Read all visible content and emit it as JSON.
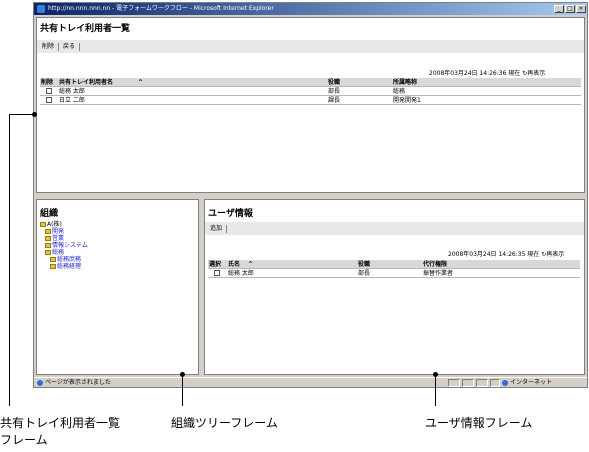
{
  "window": {
    "title": "http://nn.nnn.nnn.nn - 電子フォームワークフロー - Microsoft Internet Explorer",
    "controls": [
      "_",
      "□",
      "×"
    ]
  },
  "top_frame": {
    "title": "共有トレイ利用者一覧",
    "toolbar": [
      "削除",
      "戻る"
    ],
    "timestamp": "2008年03月24日 14:26:36 現在",
    "refresh_label": "再表示",
    "columns": [
      "削除",
      "共有トレイ利用者名",
      "役職",
      "所属略称"
    ],
    "rows": [
      {
        "name": "総務 太郎",
        "position": "部長",
        "dept": "総務"
      },
      {
        "name": "日立 二郎",
        "position": "課長",
        "dept": "開発開発1"
      }
    ]
  },
  "left_frame": {
    "title": "組織",
    "tree": [
      {
        "label": "A(株)",
        "level": 0
      },
      {
        "label": "開発",
        "level": 1
      },
      {
        "label": "営業",
        "level": 1
      },
      {
        "label": "情報システム",
        "level": 1
      },
      {
        "label": "総務",
        "level": 1
      },
      {
        "label": "総務庶務",
        "level": 2
      },
      {
        "label": "総務経理",
        "level": 2
      }
    ]
  },
  "right_frame": {
    "title": "ユーザ情報",
    "toolbar": [
      "追加"
    ],
    "timestamp": "2008年03月24日 14:26:35 現在",
    "refresh_label": "再表示",
    "columns": [
      "選択",
      "氏名",
      "役職",
      "代行権限"
    ],
    "rows": [
      {
        "name": "総務 太郎",
        "position": "部長",
        "right": "振替作業者"
      }
    ]
  },
  "status_bar": {
    "message": "ページが表示されました",
    "zone": "インターネット"
  },
  "captions": {
    "top": "共有トレイ利用者一覧\nフレーム",
    "top_line1": "共有トレイ利用者一覧",
    "top_line2": "フレーム",
    "tree": "組織ツリーフレーム",
    "user": "ユーザ情報フレーム"
  }
}
